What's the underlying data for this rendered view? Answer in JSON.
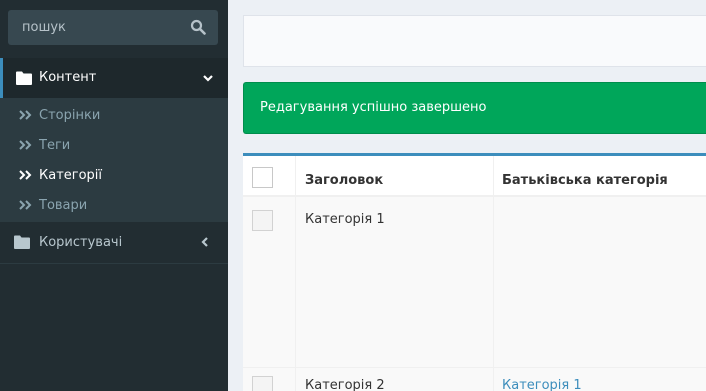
{
  "search": {
    "placeholder": "пошук",
    "icon": "search-icon"
  },
  "sidebar": {
    "content_menu": {
      "label": "Контент",
      "icon": "folder-icon",
      "expanded": true
    },
    "submenu": [
      {
        "label": "Сторінки",
        "active": false
      },
      {
        "label": "Теги",
        "active": false
      },
      {
        "label": "Категорії",
        "active": true
      },
      {
        "label": "Товари",
        "active": false
      }
    ],
    "users_menu": {
      "label": "Користувачі",
      "icon": "folder-icon",
      "expanded": false
    }
  },
  "alert": {
    "message": "Редагування успішно завершено",
    "color": "#00a65a"
  },
  "table": {
    "columns": {
      "title": "Заголовок",
      "parent": "Батьківська категорія"
    },
    "rows": [
      {
        "title": "Категорія 1",
        "parent": ""
      },
      {
        "title": "Категорія 2",
        "parent": "Категорія 1"
      }
    ]
  }
}
